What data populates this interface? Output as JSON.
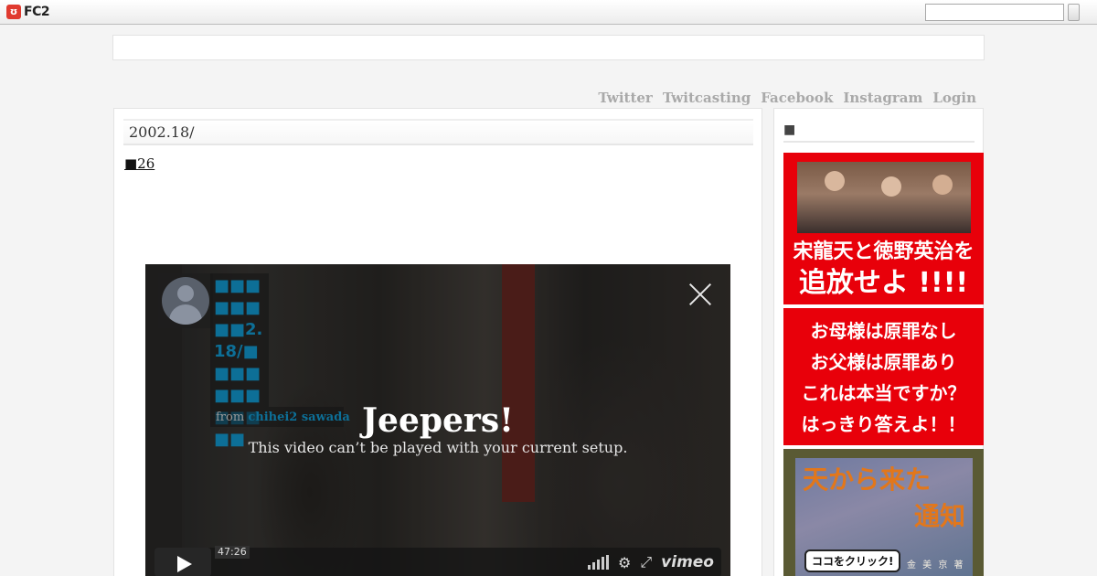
{
  "fc2_bar": {
    "logo_mark": "ʊ",
    "logo_text": "FC2",
    "search_placeholder": ""
  },
  "top_nav": [
    "Twitter",
    "Twitcasting",
    "Facebook",
    "Instagram",
    "Login"
  ],
  "post": {
    "title": "2002.18/",
    "link_text": "■26"
  },
  "video": {
    "title": "■■■■■■■■2.18/■■■■■■■■■■■■",
    "byline_from": "from",
    "byline_author": "chihei2 sawada",
    "error_heading": "Jeepers!",
    "error_message": "This video can’t be played with your current setup.",
    "timecode": "47:26",
    "brand": "vimeo",
    "icons": [
      "close-icon",
      "play-icon",
      "volume-icon",
      "gear-icon",
      "fullscreen-icon"
    ]
  },
  "sidebar": {
    "heading": "■",
    "ads": [
      {
        "line1": "宋龍天と徳野英治を",
        "line2": "追放せよ !!!!",
        "color": "#e8000a"
      },
      {
        "lines": [
          "お母様は原罪なし",
          "お父様は原罪あり",
          "これは本当ですか？",
          "はっきり答えよ！！"
        ],
        "color": "#e8000a"
      },
      {
        "title1": "天から来た",
        "title2": "通知",
        "button": "ココをクリック!",
        "author": "金 美 京 著"
      }
    ]
  },
  "colors": {
    "accent_red": "#e8000a",
    "nav_gray": "#a9a9a9",
    "vimeo_blue": "#0d6f97"
  }
}
